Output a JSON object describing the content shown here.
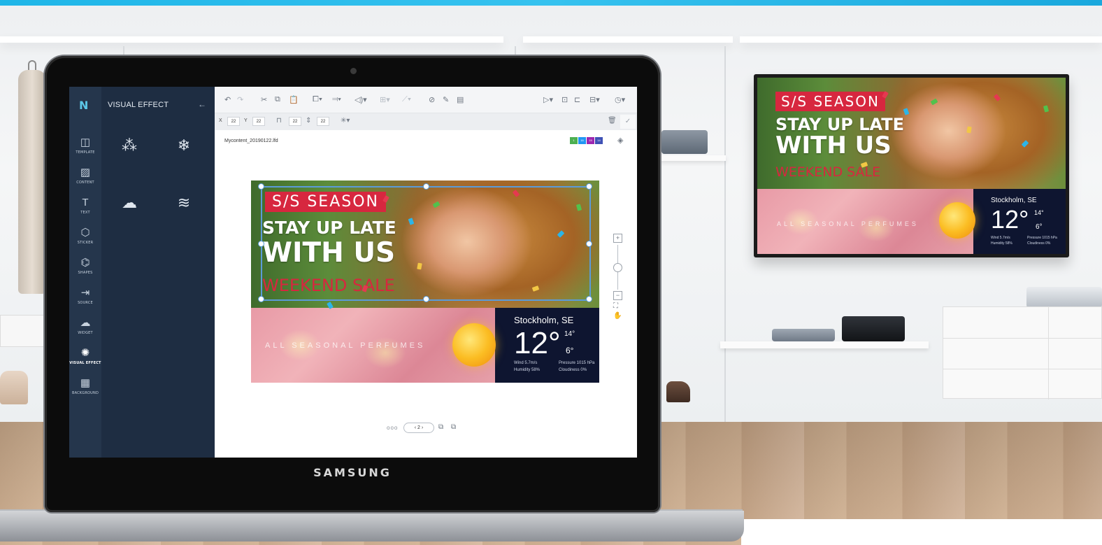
{
  "scene": {
    "brand": "SAMSUNG"
  },
  "app": {
    "logo": "N",
    "panel_title": "VISUAL EFFECT",
    "back_icon": "←",
    "rail": [
      {
        "icon": "template-icon",
        "glyph": "◫",
        "label": "TEMPLATE"
      },
      {
        "icon": "content-icon",
        "glyph": "▨",
        "label": "CONTENT"
      },
      {
        "icon": "text-icon",
        "glyph": "T",
        "label": "TEXT"
      },
      {
        "icon": "sticker-icon",
        "glyph": "⬡",
        "label": "STICKER"
      },
      {
        "icon": "shapes-icon",
        "glyph": "⌬",
        "label": "SHAPES"
      },
      {
        "icon": "source-icon",
        "glyph": "⇥",
        "label": "SOURCE"
      },
      {
        "icon": "widget-icon",
        "glyph": "☁",
        "label": "WIDGET"
      },
      {
        "icon": "visual-effect-icon",
        "glyph": "✺",
        "label": "VISUAL EFFECT"
      },
      {
        "icon": "background-icon",
        "glyph": "▦",
        "label": "BACKGROUND"
      }
    ],
    "effects": [
      {
        "name": "confetti-effect",
        "glyph": "⁂"
      },
      {
        "name": "snow-effect",
        "glyph": "❄"
      },
      {
        "name": "rain-effect",
        "glyph": "☁"
      },
      {
        "name": "heat-effect",
        "glyph": "≋"
      }
    ],
    "coords": {
      "x_label": "X",
      "x": "22",
      "y_label": "Y",
      "y": "22",
      "w": "22",
      "h": "22"
    },
    "filename": "Mycontent_20190122.lfd",
    "chips": [
      "1",
      "16",
      "15",
      "14"
    ],
    "pager": {
      "dots": "ooo",
      "page": "2"
    }
  },
  "signage": {
    "badge": "S/S SEASON",
    "headline1": "STAY UP LATE",
    "headline2": "WITH US",
    "sale": "WEEKEND SALE",
    "perfume": "ALL SEASONAL PERFUMES",
    "city": "Stockholm, SE",
    "temp": "12°",
    "hi": "14°",
    "lo": "6°",
    "wind": "Wind 5.7m/s",
    "humidity": "Humidity 58%",
    "pressure": "Pressure 1015 hPa",
    "cloudiness": "Cloudiness 0%"
  },
  "colors": {
    "accent_red": "#d7273f",
    "rail": "#25364c",
    "panel": "#1e2d42",
    "selection": "#5b9bd8",
    "chip_colors": [
      "#4caf50",
      "#2196f3",
      "#9c27b0",
      "#3f51b5"
    ]
  }
}
